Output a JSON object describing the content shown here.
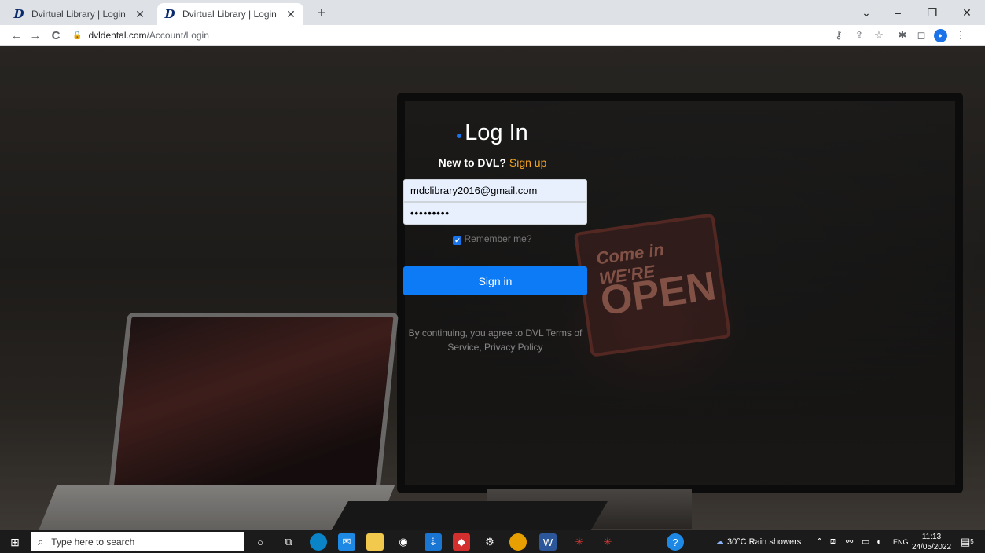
{
  "browser": {
    "tabs": [
      {
        "title": "Dvirtual Library | Login",
        "favicon": "D",
        "active": false
      },
      {
        "title": "Dvirtual Library | Login",
        "favicon": "D",
        "active": true
      }
    ],
    "new_tab": "+",
    "window_controls": {
      "minimize": "–",
      "restore": "❐",
      "close": "✕",
      "tab_search": "⌄"
    },
    "nav": {
      "back": "←",
      "forward": "→",
      "reload": "C"
    },
    "address": {
      "host": "dvldental.com",
      "path": "/Account/Login",
      "lock": "🔒"
    },
    "toolbar_icons": {
      "key": "⚷",
      "share": "⇪",
      "star": "☆",
      "extensions": "✱",
      "sidepanel": "◻",
      "profile": "●",
      "menu": "⋮"
    }
  },
  "login": {
    "title": "Log In",
    "new_to": "New to DVL?",
    "signup_link": "Sign up",
    "email_value": "mdclibrary2016@gmail.com",
    "password_value": "•••••••••",
    "remember_label": "Remember me?",
    "remember_checked": true,
    "signin_label": "Sign in",
    "terms_text": "By continuing, you agree to DVL Terms of Service, Privacy Policy"
  },
  "taskbar": {
    "search_placeholder": "Type here to search",
    "weather": "30°C  Rain showers",
    "language": "ENG",
    "time": "11:13",
    "date": "24/05/2022",
    "notifications": "5"
  },
  "colors": {
    "accent": "#0d7bf5",
    "signup": "#f5a623"
  }
}
